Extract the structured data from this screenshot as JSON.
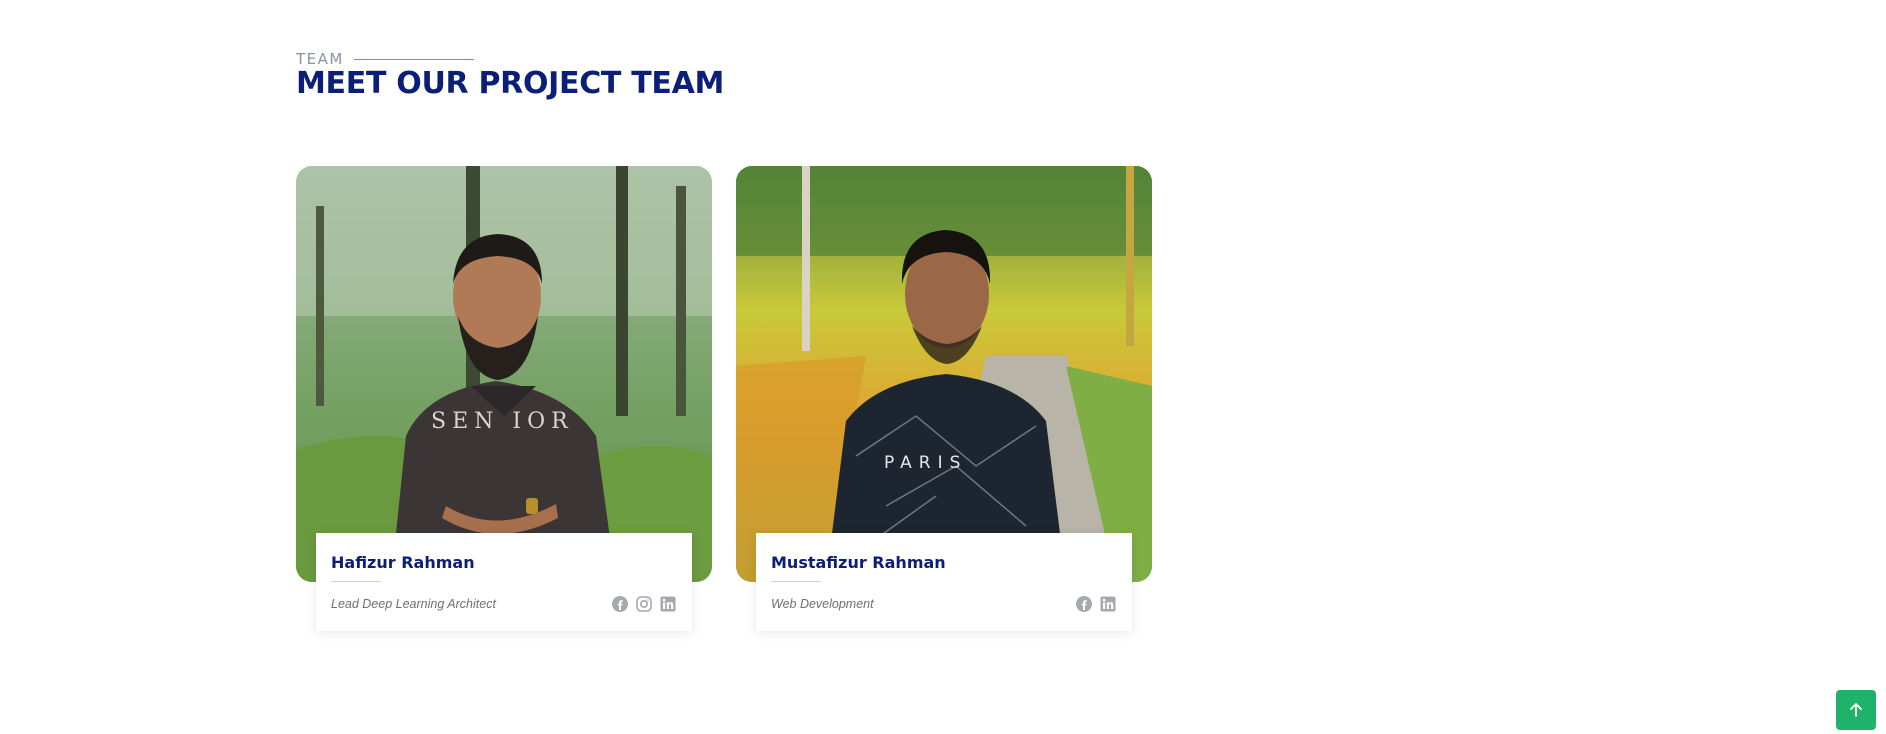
{
  "section": {
    "eyebrow": "TEAM",
    "title": "MEET OUR PROJECT TEAM"
  },
  "members": [
    {
      "name": "Hafizur Rahman",
      "role": "Lead Deep Learning Architect",
      "socials": [
        "facebook-icon",
        "instagram-icon",
        "linkedin-icon"
      ]
    },
    {
      "name": "Mustafizur Rahman",
      "role": "Web Development",
      "socials": [
        "facebook-icon",
        "linkedin-icon"
      ]
    }
  ],
  "back_to_top": {
    "icon": "arrow-up-icon"
  },
  "colors": {
    "title": "#0b1f78",
    "eyebrow": "#8a93a6",
    "accent_line": "#2bb3c0",
    "back_to_top": "#1fb36a",
    "social_icon": "#a4a8b0"
  }
}
